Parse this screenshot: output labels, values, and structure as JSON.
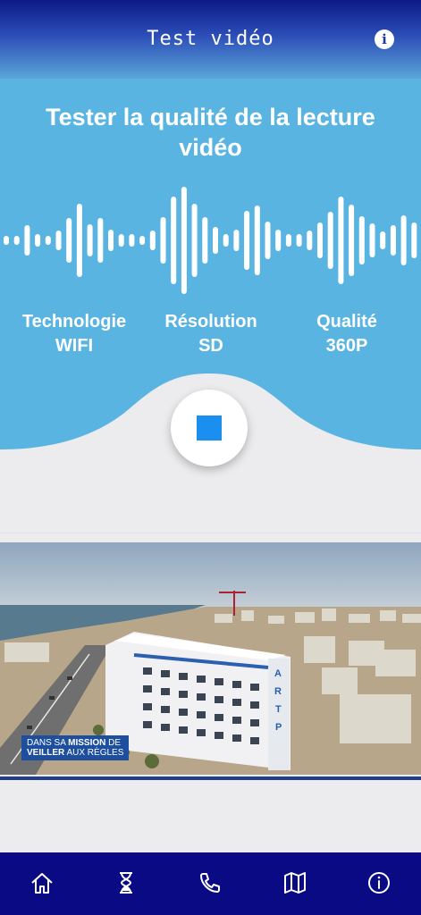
{
  "header": {
    "title": "Test vidéo",
    "info_icon": "info-icon"
  },
  "panel": {
    "title": "Tester la qualité de la lecture vidéo",
    "background": "#5ab4e2",
    "stats": [
      {
        "label": "Technologie",
        "value": "WIFI"
      },
      {
        "label": "Résolution",
        "value": "SD"
      },
      {
        "label": "Qualité",
        "value": "360P"
      }
    ],
    "stop_color": "#1b8ff0"
  },
  "video": {
    "caption_line1_a": "DANS SA ",
    "caption_line1_b": "MISSION",
    "caption_line1_c": " DE",
    "caption_line2_a": "VEILLER",
    "caption_line2_b": " AUX RÈGLES",
    "building_sign": "ARTP"
  },
  "nav": {
    "background": "#0a0a84",
    "items": [
      "home-icon",
      "hourglass-icon",
      "phone-icon",
      "map-icon",
      "info-icon"
    ]
  }
}
